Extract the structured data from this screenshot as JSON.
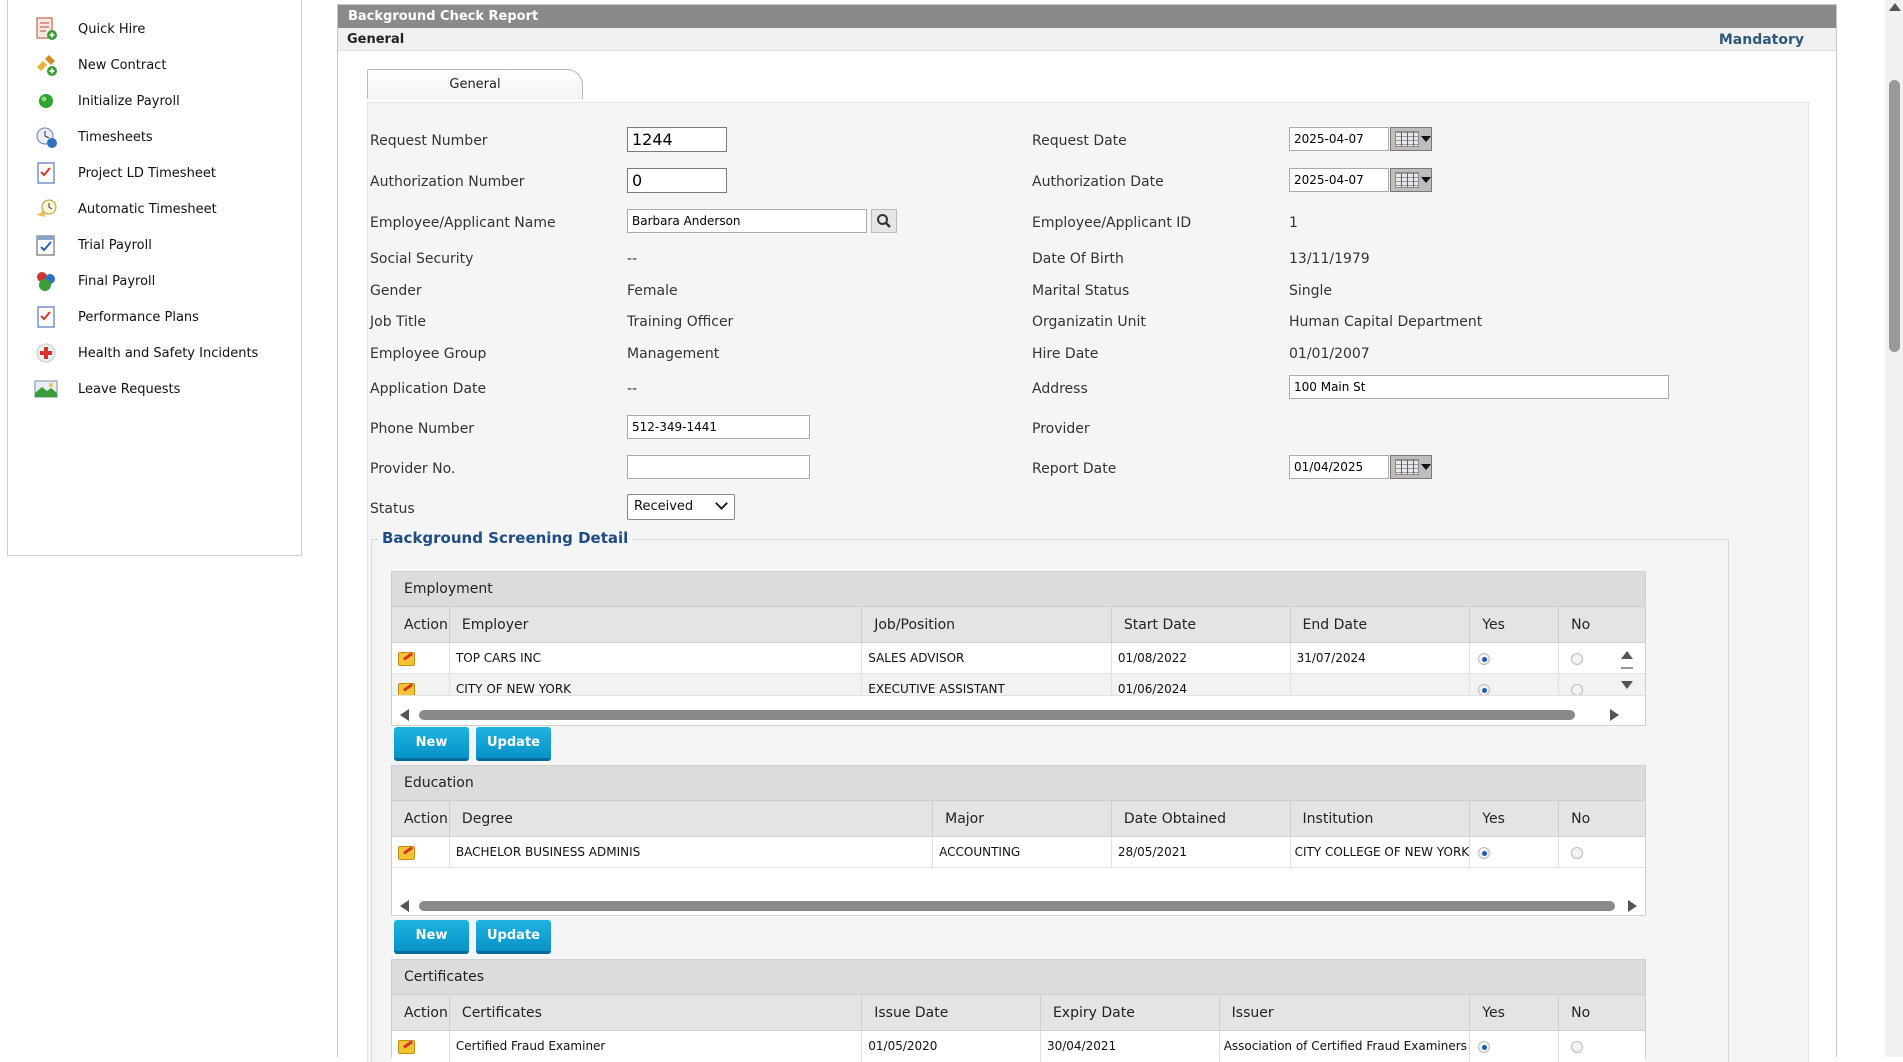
{
  "sidebar": {
    "items": [
      {
        "label": "Quick Hire",
        "icon": "quick-hire-icon"
      },
      {
        "label": "New Contract",
        "icon": "new-contract-icon"
      },
      {
        "label": "Initialize Payroll",
        "icon": "green-dot-icon"
      },
      {
        "label": "Timesheets",
        "icon": "timesheets-icon"
      },
      {
        "label": "Project LD Timesheet",
        "icon": "checklist-icon"
      },
      {
        "label": "Automatic Timesheet",
        "icon": "clock-icon"
      },
      {
        "label": "Trial Payroll",
        "icon": "calendar-check-icon"
      },
      {
        "label": "Final Payroll",
        "icon": "final-payroll-icon"
      },
      {
        "label": "Performance Plans",
        "icon": "checklist-icon"
      },
      {
        "label": "Health and Safety Incidents",
        "icon": "red-cross-icon"
      },
      {
        "label": "Leave Requests",
        "icon": "leave-icon"
      }
    ]
  },
  "panel": {
    "title": "Background Check Report",
    "subtitle": "General",
    "mandatory": "Mandatory",
    "tab": "General"
  },
  "form": {
    "request_number_label": "Request Number",
    "request_number": "1244",
    "request_date_label": "Request Date",
    "request_date": "2025-04-07",
    "authorization_number_label": "Authorization Number",
    "authorization_number": "0",
    "authorization_date_label": "Authorization Date",
    "authorization_date": "2025-04-07",
    "employee_name_label": "Employee/Applicant Name",
    "employee_name": "Barbara Anderson",
    "employee_id_label": "Employee/Applicant ID",
    "employee_id": "1",
    "social_security_label": "Social Security",
    "social_security": "--",
    "date_of_birth_label": "Date Of Birth",
    "date_of_birth": "13/11/1979",
    "gender_label": "Gender",
    "gender": "Female",
    "marital_status_label": "Marital Status",
    "marital_status": "Single",
    "job_title_label": "Job Title",
    "job_title": "Training Officer",
    "org_unit_label": "Organizatin Unit",
    "org_unit": "Human Capital Department",
    "employee_group_label": "Employee Group",
    "employee_group": "Management",
    "hire_date_label": "Hire Date",
    "hire_date": "01/01/2007",
    "application_date_label": "Application Date",
    "application_date": "--",
    "address_label": "Address",
    "address": "100 Main St",
    "phone_label": "Phone Number",
    "phone": "512-349-1441",
    "provider_label": "Provider",
    "provider_no_label": "Provider No.",
    "provider_no": "",
    "report_date_label": "Report Date",
    "report_date": "01/04/2025",
    "status_label": "Status",
    "status": "Received"
  },
  "screening": {
    "legend": "Background Screening Detail",
    "employment": {
      "title": "Employment",
      "columns": [
        "Action",
        "Employer",
        "Job/Position",
        "Start Date",
        "End Date",
        "Yes",
        "No"
      ],
      "rows": [
        [
          "TOP CARS INC",
          "SALES ADVISOR",
          "01/08/2022",
          "31/07/2024"
        ],
        [
          "CITY OF NEW YORK",
          "EXECUTIVE ASSISTANT",
          "01/06/2024",
          ""
        ]
      ]
    },
    "education": {
      "title": "Education",
      "columns": [
        "Action",
        "Degree",
        "Major",
        "Date Obtained",
        "Institution",
        "Yes",
        "No"
      ],
      "rows": [
        [
          "BACHELOR BUSINESS ADMINIS",
          "ACCOUNTING",
          "28/05/2021",
          "CITY COLLEGE OF NEW YORK"
        ]
      ]
    },
    "certificates": {
      "title": "Certificates",
      "columns": [
        "Action",
        "Certificates",
        "Issue Date",
        "Expiry Date",
        "Issuer",
        "Yes",
        "No"
      ],
      "rows": [
        [
          "Certified Fraud Examiner",
          "01/05/2020",
          "30/04/2021",
          "Association of Certified Fraud Examiners"
        ]
      ]
    },
    "new_label": "New",
    "update_label": "Update"
  }
}
